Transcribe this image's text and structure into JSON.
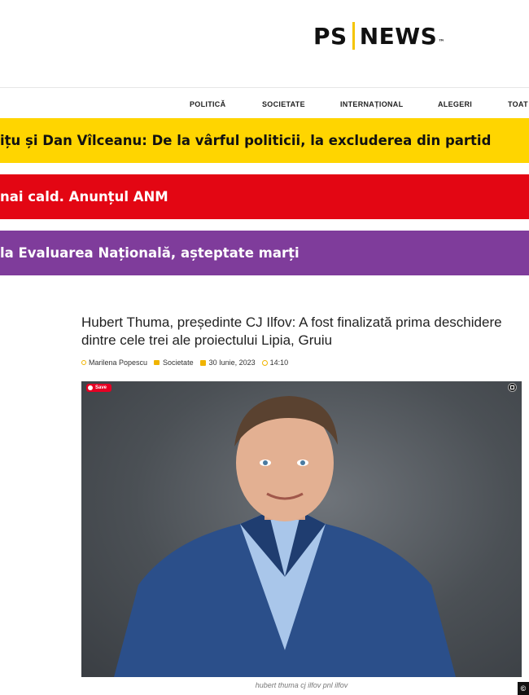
{
  "brand": {
    "logo_left": "PS",
    "logo_right": "NEWS",
    "logo_tm": "™",
    "accent": "#f5c400"
  },
  "nav": {
    "items": [
      "POLITICĂ",
      "SOCIETATE",
      "INTERNAȚIONAL",
      "ALEGERI",
      "TOAT"
    ]
  },
  "tickers": [
    {
      "text": "ițu și Dan Vîlceanu: De la vârful politicii, la excluderea din partid",
      "color": "#ffd500"
    },
    {
      "text": "nai cald. Anunțul ANM",
      "color": "#e30613"
    },
    {
      "text": "la Evaluarea Națională, așteptate marți",
      "color": "#7f3c9b"
    }
  ],
  "article": {
    "title": "Hubert Thuma, președinte CJ Ilfov: A fost finalizată prima deschidere dintre cele trei ale proiectului Lipia, Gruiu",
    "author": "Marilena Popescu",
    "category": "Societate",
    "date": "30 Iunie, 2023",
    "time": "14:10",
    "image_caption": "hubert thuma cj ilfov pnl ilfov",
    "save_label": "Save"
  },
  "corner_badge": "©"
}
